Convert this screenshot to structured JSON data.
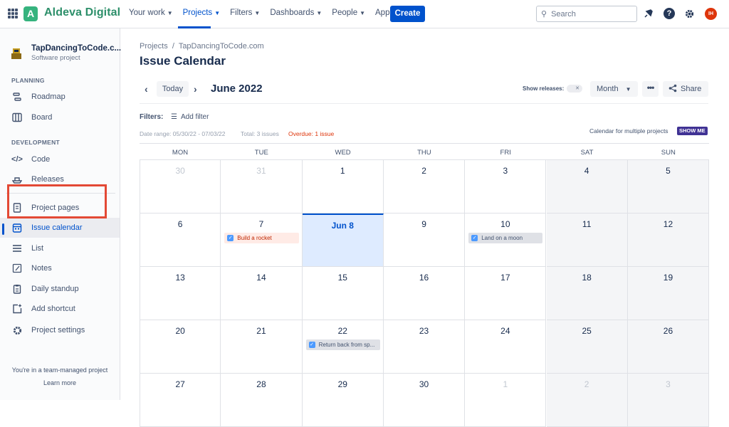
{
  "brand": {
    "logo_letter": "A",
    "name": "Aldeva Digital"
  },
  "nav": {
    "items": [
      {
        "label": "Your work"
      },
      {
        "label": "Projects"
      },
      {
        "label": "Filters"
      },
      {
        "label": "Dashboards"
      },
      {
        "label": "People"
      },
      {
        "label": "Apps"
      }
    ],
    "active": "Projects",
    "create_label": "Create",
    "search_placeholder": "Search",
    "avatar_initials": "IH"
  },
  "sidebar": {
    "project_name": "TapDancingToCode.c...",
    "project_type": "Software project",
    "planning_heading": "PLANNING",
    "development_heading": "DEVELOPMENT",
    "items": [
      {
        "label": "Roadmap",
        "icon": "roadmap-icon"
      },
      {
        "label": "Board",
        "icon": "board-icon"
      },
      {
        "label": "Code",
        "icon": "code-icon"
      },
      {
        "label": "Releases",
        "icon": "releases-icon"
      },
      {
        "label": "Project pages",
        "icon": "page-icon"
      },
      {
        "label": "Issue calendar",
        "icon": "calendar-icon"
      },
      {
        "label": "List",
        "icon": "list-icon"
      },
      {
        "label": "Notes",
        "icon": "notes-icon"
      },
      {
        "label": "Daily standup",
        "icon": "clipboard-icon"
      },
      {
        "label": "Add shortcut",
        "icon": "add-shortcut-icon"
      },
      {
        "label": "Project settings",
        "icon": "gear-icon"
      }
    ],
    "footer_text": "You're in a team-managed project",
    "learn_more": "Learn more"
  },
  "main": {
    "breadcrumb": "Projects  /  TapDancingToCode.com",
    "title": "Issue Calendar",
    "today_label": "Today",
    "month_title": "June 2022",
    "show_releases_label": "Show releases:",
    "toggle_mark": "✕",
    "view_select": "Month",
    "share_label": "Share",
    "filters_label": "Filters:",
    "add_filter_label": "Add filter",
    "date_range": "Date range: 05/30/22 - 07/03/22",
    "total": "Total: 3 issues",
    "overdue": "Overdue: 1 issue",
    "multi_calendar": "Calendar for multiple projects",
    "show_me": "SHOW ME"
  },
  "calendar": {
    "weekdays": [
      "MON",
      "TUE",
      "WED",
      "THU",
      "FRI",
      "SAT",
      "SUN"
    ],
    "weeks": [
      [
        "30",
        "31",
        "1",
        "2",
        "3",
        "4",
        "5"
      ],
      [
        "6",
        "7",
        "Jun 8",
        "9",
        "10",
        "11",
        "12"
      ],
      [
        "13",
        "14",
        "15",
        "16",
        "17",
        "18",
        "19"
      ],
      [
        "20",
        "21",
        "22",
        "23",
        "24",
        "25",
        "26"
      ],
      [
        "27",
        "28",
        "29",
        "30",
        "1",
        "2",
        "3"
      ]
    ],
    "issues": [
      {
        "title": "Build a rocket",
        "week": 1,
        "day": 1,
        "status": "overdue"
      },
      {
        "title": "Land on a moon",
        "week": 1,
        "day": 4,
        "status": "normal"
      },
      {
        "title": "Return back from sp...",
        "week": 3,
        "day": 2,
        "status": "normal"
      }
    ]
  },
  "colors": {
    "accent": "#0052CC",
    "brand": "#36B37E",
    "overdue": "#DE350B",
    "highlight": "#E34935"
  }
}
